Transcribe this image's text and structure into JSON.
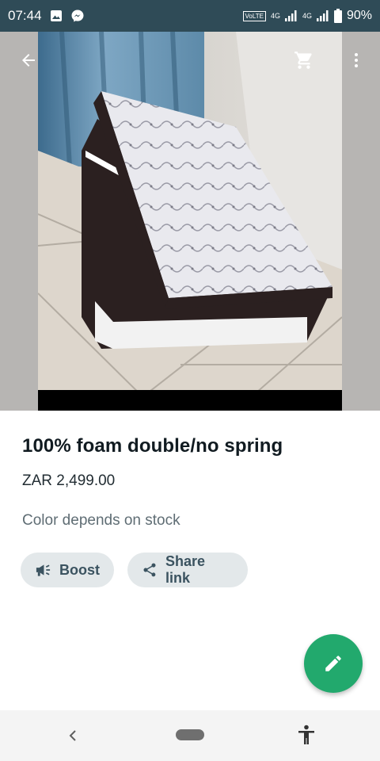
{
  "status_bar": {
    "time": "07:44",
    "volte": "VoLTE",
    "network_1": "4G",
    "network_2": "4G",
    "battery_percent": "90%",
    "icons": [
      "gallery-icon",
      "messenger-icon",
      "signal-icon",
      "battery-icon"
    ]
  },
  "app_bar": {
    "icons": [
      "back-arrow-icon",
      "cart-icon",
      "more-vert-icon"
    ]
  },
  "product": {
    "title": "100% foam double/no spring",
    "price": "ZAR 2,499.00",
    "description": "Color depends on stock"
  },
  "actions": {
    "boost_label": "Boost",
    "share_label": "Share link",
    "boost_icon": "megaphone-icon",
    "share_icon": "share-icon"
  },
  "fab": {
    "icon": "pencil-icon"
  },
  "nav": {
    "icons": [
      "nav-back-icon",
      "home-pill",
      "accessibility-icon"
    ]
  },
  "colors": {
    "status_bar": "#2f4b57",
    "accent": "#22a96d",
    "chip_bg": "#e3e8ea",
    "chip_text": "#3b5360"
  }
}
